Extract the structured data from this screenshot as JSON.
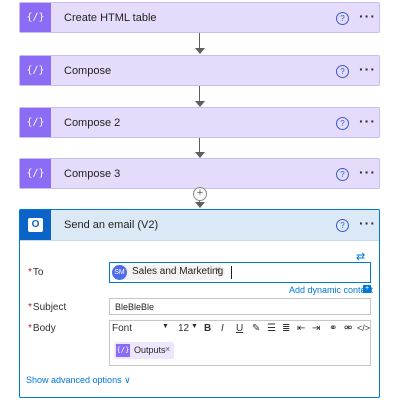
{
  "steps": [
    {
      "title": "Create HTML table",
      "icon": "braces-icon"
    },
    {
      "title": "Compose",
      "icon": "braces-icon"
    },
    {
      "title": "Compose 2",
      "icon": "braces-icon"
    },
    {
      "title": "Compose 3",
      "icon": "braces-icon"
    }
  ],
  "glyphs": {
    "braces": "{∕}",
    "help": "?",
    "more": "···",
    "plus": "+",
    "close": "×",
    "switch": "⇄",
    "chevron": "∨",
    "dropdown": "▼"
  },
  "email_action": {
    "title": "Send an email (V2)",
    "icon": "outlook-icon",
    "logo_letter": "O",
    "to_label": "To",
    "to_token_initials": "SM",
    "to_token_name": "Sales and Marketing",
    "add_dynamic_content": "Add dynamic content",
    "subject_label": "Subject",
    "subject_value": "BleBleBle",
    "body_label": "Body",
    "body_font": "Font",
    "body_font_size": "12",
    "body_token": "Outputs",
    "show_advanced": "Show advanced options",
    "required_marker": "*"
  },
  "toolbar": [
    {
      "name": "bold-icon",
      "glyph": "B"
    },
    {
      "name": "italic-icon",
      "glyph": "I"
    },
    {
      "name": "underline-icon",
      "glyph": "U"
    },
    {
      "name": "highlight-icon",
      "glyph": "✎"
    },
    {
      "name": "bulleted-list-icon",
      "glyph": "☰"
    },
    {
      "name": "numbered-list-icon",
      "glyph": "≣"
    },
    {
      "name": "decrease-indent-icon",
      "glyph": "⇤"
    },
    {
      "name": "increase-indent-icon",
      "glyph": "⇥"
    },
    {
      "name": "link-icon",
      "glyph": "⚭"
    },
    {
      "name": "unlink-icon",
      "glyph": "⚮"
    },
    {
      "name": "code-view-icon",
      "glyph": "</>"
    }
  ],
  "colors": {
    "step_bg": "#e4dcfa",
    "step_icon_bg": "#8c6cf5",
    "email_header_bg": "#dbe9f7",
    "email_icon_bg": "#0a64c8",
    "accent": "#0078d4"
  }
}
